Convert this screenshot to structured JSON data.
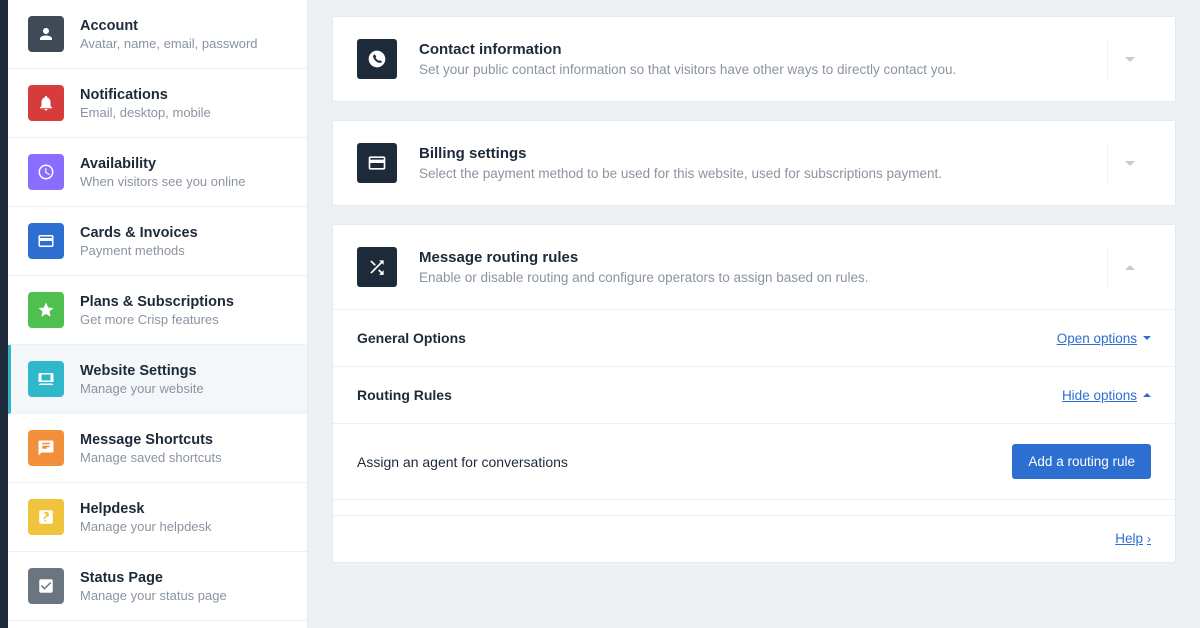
{
  "sidebar": {
    "items": [
      {
        "title": "Account",
        "sub": "Avatar, name, email, password"
      },
      {
        "title": "Notifications",
        "sub": "Email, desktop, mobile"
      },
      {
        "title": "Availability",
        "sub": "When visitors see you online"
      },
      {
        "title": "Cards & Invoices",
        "sub": "Payment methods"
      },
      {
        "title": "Plans & Subscriptions",
        "sub": "Get more Crisp features"
      },
      {
        "title": "Website Settings",
        "sub": "Manage your website"
      },
      {
        "title": "Message Shortcuts",
        "sub": "Manage saved shortcuts"
      },
      {
        "title": "Helpdesk",
        "sub": "Manage your helpdesk"
      },
      {
        "title": "Status Page",
        "sub": "Manage your status page"
      }
    ]
  },
  "panels": {
    "contact": {
      "title": "Contact information",
      "sub": "Set your public contact information so that visitors have other ways to directly contact you."
    },
    "billing": {
      "title": "Billing settings",
      "sub": "Select the payment method to be used for this website, used for subscriptions payment."
    },
    "routing": {
      "title": "Message routing rules",
      "sub": "Enable or disable routing and configure operators to assign based on rules.",
      "general_label": "General Options",
      "general_action": "Open options",
      "rules_label": "Routing Rules",
      "rules_action": "Hide options",
      "assign_label": "Assign an agent for conversations",
      "add_button": "Add a routing rule",
      "help_label": "Help"
    }
  }
}
